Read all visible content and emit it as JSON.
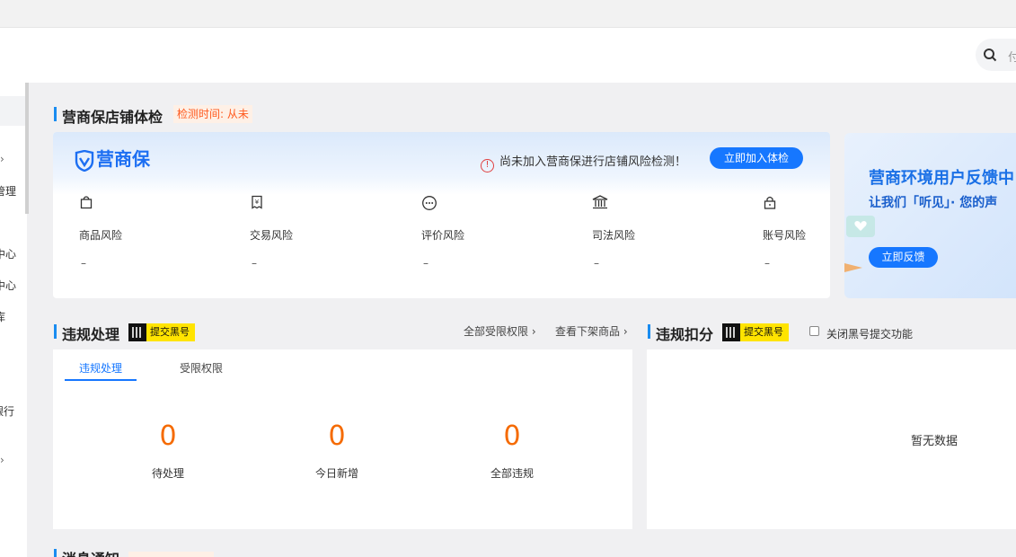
{
  "search": {
    "placeholder": "付"
  },
  "sidebar": {
    "items": [
      "管理",
      "中心",
      "中心",
      "库",
      "银行"
    ]
  },
  "shield_section": {
    "title": "营商保店铺体检",
    "check_time": "检测时间: 从未",
    "logo_text": "营商保",
    "warning": "尚未加入营商保进行店铺风险检测！",
    "join_button": "立即加入体检",
    "risks": [
      {
        "label": "商品风险",
        "value": "–",
        "icon": "shopping-bag-icon"
      },
      {
        "label": "交易风险",
        "value": "–",
        "icon": "yuan-receipt-icon"
      },
      {
        "label": "评价风险",
        "value": "–",
        "icon": "chat-bubble-icon"
      },
      {
        "label": "司法风险",
        "value": "–",
        "icon": "courthouse-icon"
      },
      {
        "label": "账号风险",
        "value": "–",
        "icon": "lock-icon"
      }
    ]
  },
  "banner": {
    "title": "营商环境用户反馈中",
    "subtitle": "让我们「听见」· 您的声",
    "button": "立即反馈"
  },
  "violation": {
    "title": "违规处理",
    "tag": "提交黑号",
    "links": [
      "全部受限权限 ›",
      "查看下架商品 ›"
    ],
    "tabs": [
      "违规处理",
      "受限权限"
    ],
    "stats": [
      {
        "value": "0",
        "label": "待处理"
      },
      {
        "value": "0",
        "label": "今日新增"
      },
      {
        "value": "0",
        "label": "全部违规"
      }
    ]
  },
  "deduction": {
    "title": "违规扣分",
    "tag": "提交黑号",
    "checkbox_label": "关闭黑号提交功能",
    "empty": "暂无数据"
  },
  "notice": {
    "title": "消息通知"
  },
  "colors": {
    "accent": "#1677ff",
    "number": "#f56a00",
    "tag": "#ffe400"
  }
}
